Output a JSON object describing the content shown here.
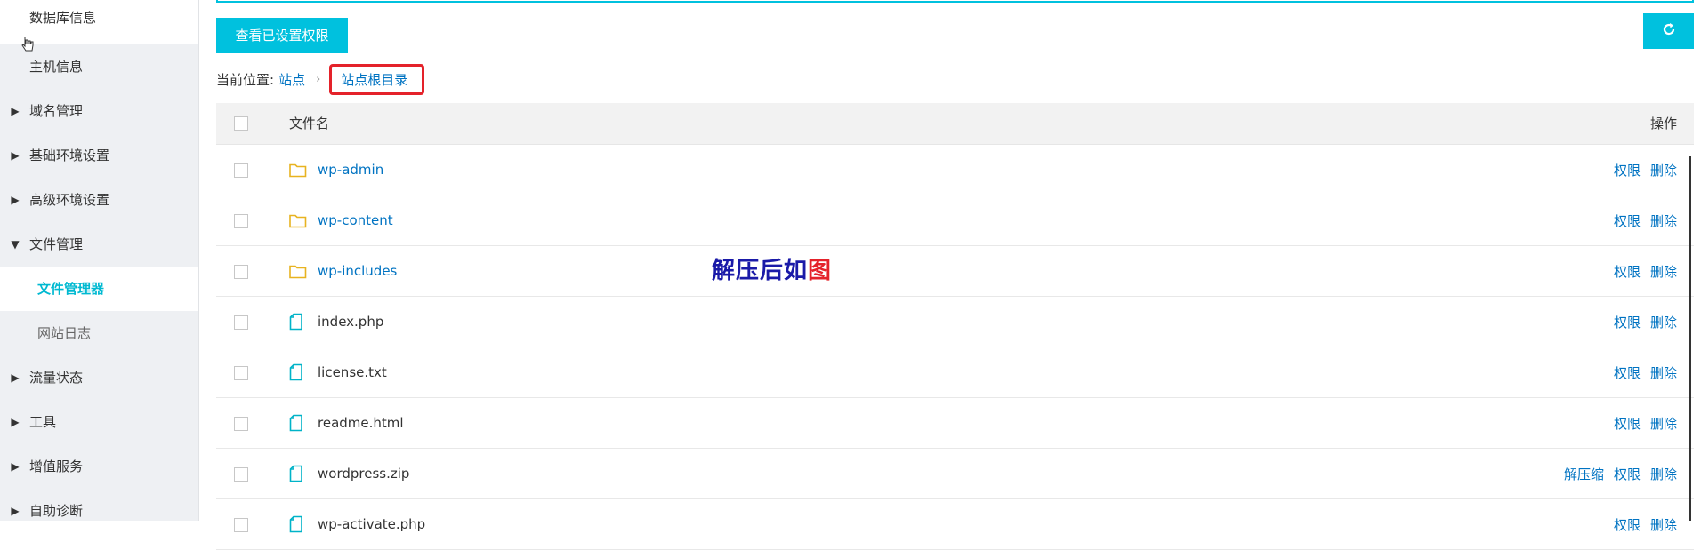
{
  "sidebar": {
    "items": [
      {
        "label": "数据库信息"
      },
      {
        "label": "主机信息"
      },
      {
        "label": "域名管理"
      },
      {
        "label": "基础环境设置"
      },
      {
        "label": "高级环境设置"
      },
      {
        "label": "文件管理"
      },
      {
        "label": "文件管理器"
      },
      {
        "label": "网站日志"
      },
      {
        "label": "流量状态"
      },
      {
        "label": "工具"
      },
      {
        "label": "增值服务"
      },
      {
        "label": "自助诊断"
      }
    ]
  },
  "toolbar": {
    "view_permissions_label": "查看已设置权限",
    "refresh_icon": "refresh-icon"
  },
  "breadcrumb": {
    "prefix": "当前位置:",
    "root": "站点",
    "separator": "›",
    "current": "站点根目录"
  },
  "table": {
    "headers": {
      "name": "文件名",
      "ops": "操作"
    },
    "rows": [
      {
        "type": "folder",
        "name": "wp-admin",
        "ops": [
          "权限",
          "删除"
        ]
      },
      {
        "type": "folder",
        "name": "wp-content",
        "ops": [
          "权限",
          "删除"
        ]
      },
      {
        "type": "folder",
        "name": "wp-includes",
        "ops": [
          "权限",
          "删除"
        ]
      },
      {
        "type": "file",
        "name": "index.php",
        "ops": [
          "权限",
          "删除"
        ]
      },
      {
        "type": "file",
        "name": "license.txt",
        "ops": [
          "权限",
          "删除"
        ]
      },
      {
        "type": "file",
        "name": "readme.html",
        "ops": [
          "权限",
          "删除"
        ]
      },
      {
        "type": "file",
        "name": "wordpress.zip",
        "ops": [
          "解压缩",
          "权限",
          "删除"
        ]
      },
      {
        "type": "file",
        "name": "wp-activate.php",
        "ops": [
          "权限",
          "删除"
        ]
      }
    ]
  },
  "annotation": {
    "text_blue": "解压后如",
    "text_red": "图"
  },
  "colors": {
    "accent": "#00c1de",
    "link": "#0073c2",
    "highlight_box": "#e4222a",
    "folder": "#e8b320",
    "file": "#00b3c8"
  }
}
